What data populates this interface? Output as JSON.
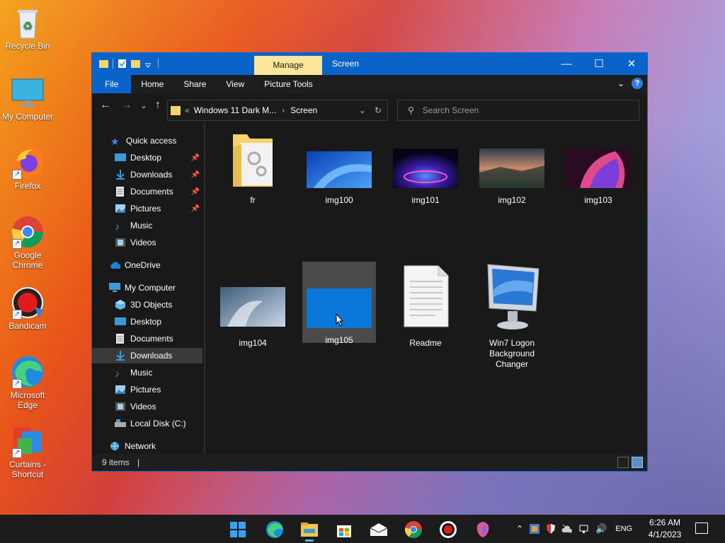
{
  "desktop": {
    "icons": [
      {
        "label": "Recycle Bin"
      },
      {
        "label": "My Computer"
      },
      {
        "label": "Firefox"
      },
      {
        "label": "Google Chrome"
      },
      {
        "label": "Bandicam"
      },
      {
        "label": "Microsoft Edge"
      },
      {
        "label": "Curtains - Shortcut"
      }
    ]
  },
  "window": {
    "title": "Screen",
    "context_tab": "Manage",
    "ribbon_tabs": [
      "File",
      "Home",
      "Share",
      "View",
      "Picture Tools"
    ],
    "address": {
      "root": "Windows 11 Dark M...",
      "current": "Screen",
      "prefix": "«"
    },
    "search_placeholder": "Search Screen"
  },
  "nav": {
    "quick_access": "Quick access",
    "quick_items": [
      "Desktop",
      "Downloads",
      "Documents",
      "Pictures",
      "Music",
      "Videos"
    ],
    "onedrive": "OneDrive",
    "my_computer": "My Computer",
    "pc_items": [
      "3D Objects",
      "Desktop",
      "Documents",
      "Downloads",
      "Music",
      "Pictures",
      "Videos",
      "Local Disk (C:)"
    ],
    "network": "Network",
    "selected": "Downloads"
  },
  "files": [
    {
      "name": "fr",
      "type": "folder"
    },
    {
      "name": "img100",
      "type": "image"
    },
    {
      "name": "img101",
      "type": "image"
    },
    {
      "name": "img102",
      "type": "image"
    },
    {
      "name": "img103",
      "type": "image"
    },
    {
      "name": "img104",
      "type": "image"
    },
    {
      "name": "img105",
      "type": "image",
      "selected": true
    },
    {
      "name": "Readme",
      "type": "text"
    },
    {
      "name": "Win7 Logon Background Changer",
      "type": "app"
    }
  ],
  "status": {
    "item_count": "9 items"
  },
  "taskbar": {
    "apps": [
      "start-icon",
      "edge-icon",
      "file-explorer-icon",
      "store-icon",
      "mail-icon",
      "chrome-icon",
      "record-icon",
      "copilot-icon"
    ],
    "language": "ENG",
    "time": "6:26 AM",
    "date": "4/1/2023"
  },
  "colors": {
    "accent": "#0a63c9",
    "manage_tab": "#fbe69a",
    "window_bg": "#191919"
  }
}
